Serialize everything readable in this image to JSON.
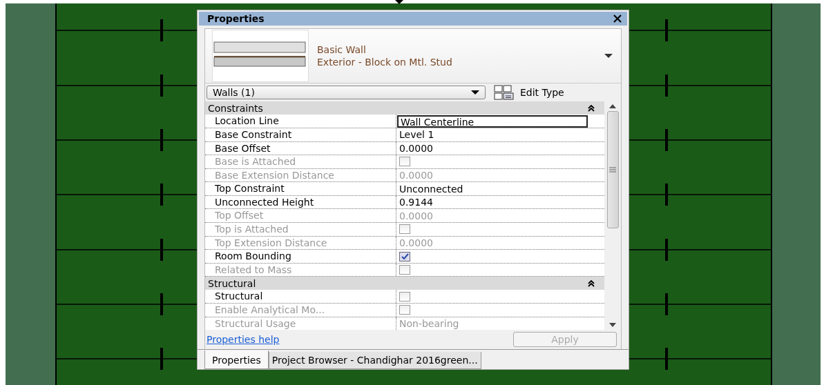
{
  "panel": {
    "title": "Properties",
    "type_selector": {
      "family": "Basic Wall",
      "type": "Exterior - Block on Mtl. Stud"
    },
    "filter": {
      "value": "Walls (1)"
    },
    "edit_type": {
      "label": "Edit Type"
    },
    "groups": [
      {
        "title": "Constraints",
        "expanded": true,
        "rows": [
          {
            "name": "Location Line",
            "kind": "field",
            "value": "Wall Centerline",
            "disabled": false
          },
          {
            "name": "Base Constraint",
            "kind": "text",
            "value": "Level 1",
            "disabled": false
          },
          {
            "name": "Base Offset",
            "kind": "text",
            "value": "0.0000",
            "disabled": false
          },
          {
            "name": "Base is Attached",
            "kind": "checkbox",
            "checked": false,
            "disabled": true
          },
          {
            "name": "Base Extension Distance",
            "kind": "text",
            "value": "0.0000",
            "disabled": true
          },
          {
            "name": "Top Constraint",
            "kind": "text",
            "value": "Unconnected",
            "disabled": false
          },
          {
            "name": "Unconnected Height",
            "kind": "text",
            "value": "0.9144",
            "disabled": false
          },
          {
            "name": "Top Offset",
            "kind": "text",
            "value": "0.0000",
            "disabled": true
          },
          {
            "name": "Top is Attached",
            "kind": "checkbox",
            "checked": false,
            "disabled": true
          },
          {
            "name": "Top Extension Distance",
            "kind": "text",
            "value": "0.0000",
            "disabled": true
          },
          {
            "name": "Room Bounding",
            "kind": "checkbox",
            "checked": true,
            "disabled": false
          },
          {
            "name": "Related to Mass",
            "kind": "checkbox",
            "checked": false,
            "disabled": true
          }
        ]
      },
      {
        "title": "Structural",
        "expanded": true,
        "rows": [
          {
            "name": "Structural",
            "kind": "checkbox",
            "checked": false,
            "disabled": false
          },
          {
            "name": "Enable Analytical Mo...",
            "kind": "checkbox",
            "checked": false,
            "disabled": true
          },
          {
            "name": "Structural Usage",
            "kind": "text",
            "value": "Non-bearing",
            "disabled": true
          }
        ]
      }
    ],
    "help_link": "Properties help",
    "apply": {
      "label": "Apply",
      "disabled": true
    },
    "tabs": [
      {
        "label": "Properties",
        "selected": true
      },
      {
        "label": "Project Browser - Chandighar 2016green...",
        "selected": false
      }
    ]
  }
}
